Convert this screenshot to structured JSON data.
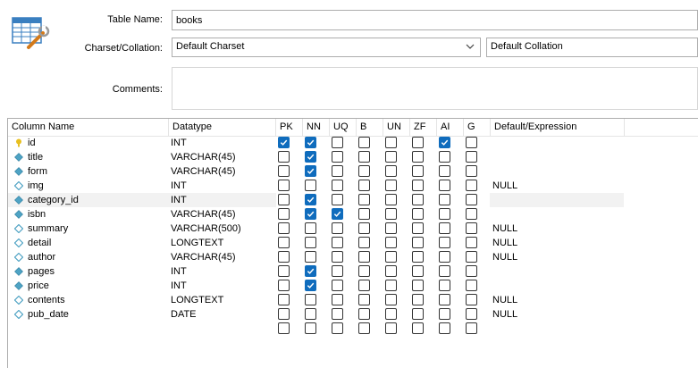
{
  "form": {
    "table_name_label": "Table Name:",
    "table_name_value": "books",
    "charset_label": "Charset/Collation:",
    "charset_value": "Default Charset",
    "collation_value": "Default Collation",
    "comments_label": "Comments:",
    "comments_value": ""
  },
  "grid": {
    "headers": {
      "name": "Column Name",
      "type": "Datatype",
      "pk": "PK",
      "nn": "NN",
      "uq": "UQ",
      "b": "B",
      "un": "UN",
      "zf": "ZF",
      "ai": "AI",
      "g": "G",
      "def": "Default/Expression"
    },
    "rows": [
      {
        "name": "id",
        "type": "INT",
        "key": "primary-key",
        "pk": true,
        "nn": true,
        "uq": false,
        "b": false,
        "un": false,
        "zf": false,
        "ai": true,
        "g": false,
        "def": ""
      },
      {
        "name": "title",
        "type": "VARCHAR(45)",
        "key": "column-not-null",
        "pk": false,
        "nn": true,
        "uq": false,
        "b": false,
        "un": false,
        "zf": false,
        "ai": false,
        "g": false,
        "def": ""
      },
      {
        "name": "form",
        "type": "VARCHAR(45)",
        "key": "column-not-null",
        "pk": false,
        "nn": true,
        "uq": false,
        "b": false,
        "un": false,
        "zf": false,
        "ai": false,
        "g": false,
        "def": ""
      },
      {
        "name": "img",
        "type": "INT",
        "key": "column-nullable",
        "pk": false,
        "nn": false,
        "uq": false,
        "b": false,
        "un": false,
        "zf": false,
        "ai": false,
        "g": false,
        "def": "NULL"
      },
      {
        "name": "category_id",
        "type": "INT",
        "key": "column-not-null",
        "pk": false,
        "nn": true,
        "uq": false,
        "b": false,
        "un": false,
        "zf": false,
        "ai": false,
        "g": false,
        "def": "",
        "selected": true
      },
      {
        "name": "isbn",
        "type": "VARCHAR(45)",
        "key": "column-not-null",
        "pk": false,
        "nn": true,
        "uq": true,
        "b": false,
        "un": false,
        "zf": false,
        "ai": false,
        "g": false,
        "def": ""
      },
      {
        "name": "summary",
        "type": "VARCHAR(500)",
        "key": "column-nullable",
        "pk": false,
        "nn": false,
        "uq": false,
        "b": false,
        "un": false,
        "zf": false,
        "ai": false,
        "g": false,
        "def": "NULL"
      },
      {
        "name": "detail",
        "type": "LONGTEXT",
        "key": "column-nullable",
        "pk": false,
        "nn": false,
        "uq": false,
        "b": false,
        "un": false,
        "zf": false,
        "ai": false,
        "g": false,
        "def": "NULL"
      },
      {
        "name": "author",
        "type": "VARCHAR(45)",
        "key": "column-nullable",
        "pk": false,
        "nn": false,
        "uq": false,
        "b": false,
        "un": false,
        "zf": false,
        "ai": false,
        "g": false,
        "def": "NULL"
      },
      {
        "name": "pages",
        "type": "INT",
        "key": "column-not-null",
        "pk": false,
        "nn": true,
        "uq": false,
        "b": false,
        "un": false,
        "zf": false,
        "ai": false,
        "g": false,
        "def": ""
      },
      {
        "name": "price",
        "type": "INT",
        "key": "column-not-null",
        "pk": false,
        "nn": true,
        "uq": false,
        "b": false,
        "un": false,
        "zf": false,
        "ai": false,
        "g": false,
        "def": ""
      },
      {
        "name": "contents",
        "type": "LONGTEXT",
        "key": "column-nullable",
        "pk": false,
        "nn": false,
        "uq": false,
        "b": false,
        "un": false,
        "zf": false,
        "ai": false,
        "g": false,
        "def": "NULL"
      },
      {
        "name": "pub_date",
        "type": "DATE",
        "key": "column-nullable",
        "pk": false,
        "nn": false,
        "uq": false,
        "b": false,
        "un": false,
        "zf": false,
        "ai": false,
        "g": false,
        "def": "NULL"
      },
      {
        "name": "",
        "type": "",
        "key": "",
        "pk": false,
        "nn": false,
        "uq": false,
        "b": false,
        "un": false,
        "zf": false,
        "ai": false,
        "g": false,
        "def": ""
      }
    ]
  },
  "colors": {
    "checkbox_checked": "#0f6cbd",
    "primary_key_icon": "#e8c020",
    "column_icon": "#4fa3c4"
  },
  "icons": {
    "table": "table-editor-icon",
    "primary_key": "key-icon",
    "column": "column-diamond-icon"
  }
}
